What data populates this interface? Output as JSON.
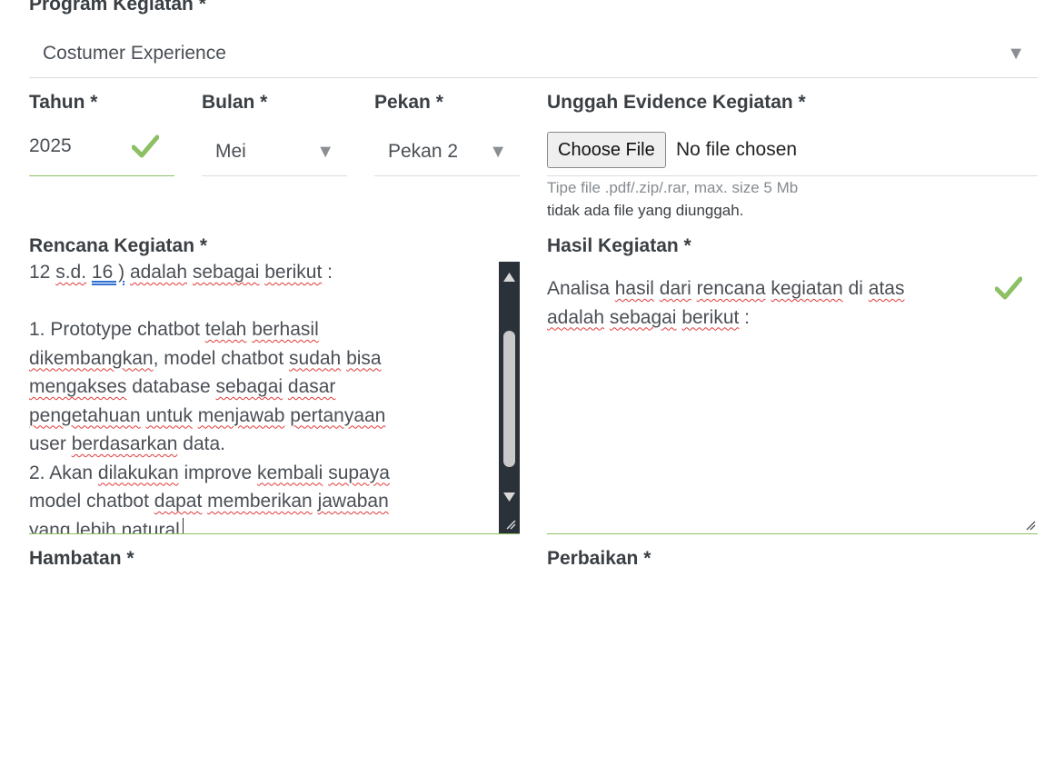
{
  "program": {
    "label": "Program Kegiatan *",
    "value": "Costumer Experience"
  },
  "tahun": {
    "label": "Tahun *",
    "value": "2025"
  },
  "bulan": {
    "label": "Bulan *",
    "value": "Mei"
  },
  "pekan": {
    "label": "Pekan *",
    "value": "Pekan 2"
  },
  "evidence": {
    "label": "Unggah Evidence Kegiatan *",
    "button": "Choose File",
    "status": "No file chosen",
    "hint": "Tipe file .pdf/.zip/.rar, max. size 5 Mb",
    "note": "tidak ada file yang diunggah."
  },
  "rencana": {
    "label": "Rencana Kegiatan *",
    "lines": [
      [
        "12 ",
        {
          "s": "s.d."
        },
        " ",
        {
          "b": "16 )"
        },
        " ",
        {
          "s": "adalah"
        },
        " ",
        {
          "s": "sebagai"
        },
        " ",
        {
          "s": "berikut"
        },
        " :"
      ],
      [
        ""
      ],
      [
        "1. Prototype chatbot ",
        {
          "s": "telah"
        },
        " ",
        {
          "s": "berhasil"
        }
      ],
      [
        {
          "s": "dikembangkan"
        },
        ", model chatbot ",
        {
          "s": "sudah"
        },
        " ",
        {
          "s": "bisa"
        }
      ],
      [
        {
          "s": "mengakses"
        },
        " database ",
        {
          "s": "sebagai"
        },
        " ",
        {
          "s": "dasar"
        }
      ],
      [
        {
          "s": "pengetahuan"
        },
        " ",
        {
          "s": "untuk"
        },
        " ",
        {
          "s": "menjawab"
        },
        " ",
        {
          "s": "pertanyaan"
        }
      ],
      [
        "user ",
        {
          "s": "berdasarkan"
        },
        " data."
      ],
      [
        "2. Akan ",
        {
          "s": "dilakukan"
        },
        " improve ",
        {
          "s": "kembali"
        },
        " ",
        {
          "s": "supaya"
        }
      ],
      [
        "model chatbot ",
        {
          "s": "dapat"
        },
        " ",
        {
          "s": "memberikan"
        },
        " ",
        {
          "s": "jawaban"
        }
      ],
      [
        "yang lebih natural"
      ]
    ]
  },
  "hasil": {
    "label": "Hasil Kegiatan *",
    "lines": [
      [
        "Analisa ",
        {
          "s": "hasil"
        },
        " ",
        {
          "s": "dari"
        },
        " ",
        {
          "s": "rencana"
        },
        " ",
        {
          "s": "kegiatan"
        },
        " di ",
        {
          "s": "atas"
        }
      ],
      [
        {
          "s": "adalah"
        },
        " ",
        {
          "s": "sebagai"
        },
        " ",
        {
          "s": "berikut"
        },
        " :"
      ]
    ]
  },
  "hambatan": {
    "label": "Hambatan *"
  },
  "perbaikan": {
    "label": "Perbaikan *"
  },
  "icons": {
    "check": "checkmark-icon",
    "dropdown": "triangle-down-icon",
    "scroll_up": "scroll-up-arrow-icon",
    "scroll_down": "scroll-down-arrow-icon",
    "resize": "resize-grip-icon"
  },
  "colors": {
    "valid": "#8cc063",
    "spell_error": "#e03a3a",
    "scrollbar": "#2b3138"
  }
}
